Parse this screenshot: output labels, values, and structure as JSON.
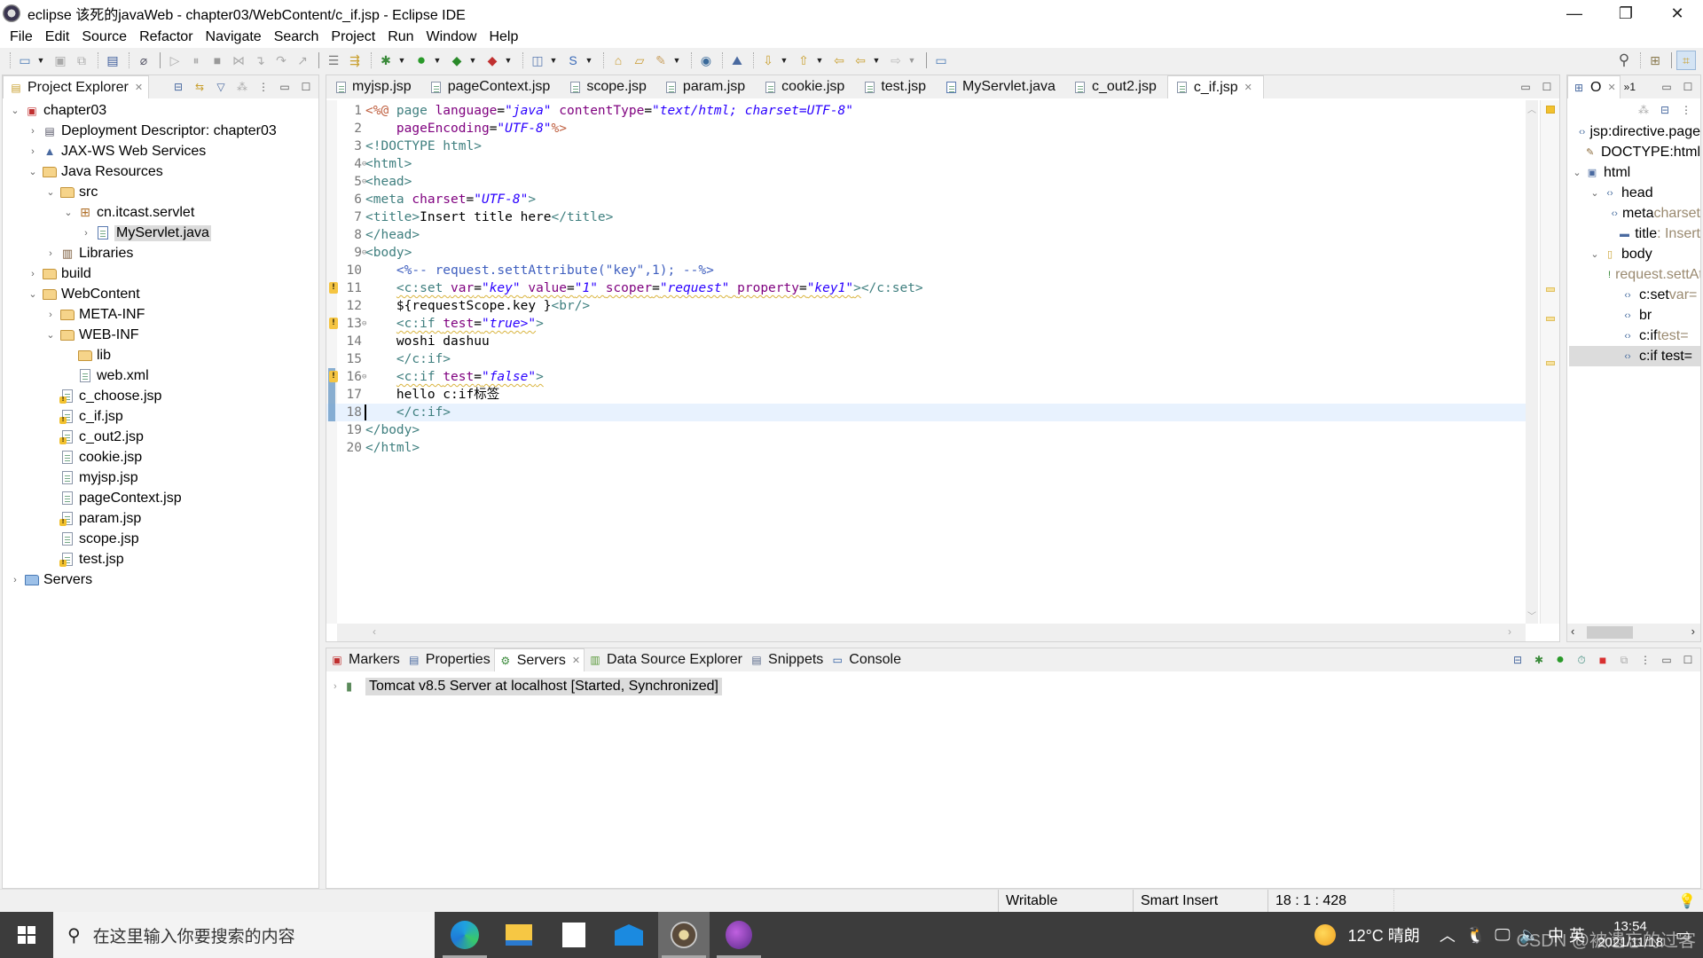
{
  "window": {
    "title": "eclipse 该死的javaWeb - chapter03/WebContent/c_if.jsp - Eclipse IDE",
    "minimize": "—",
    "restore": "❐",
    "close": "✕"
  },
  "menu": [
    "File",
    "Edit",
    "Source",
    "Refactor",
    "Navigate",
    "Search",
    "Project",
    "Run",
    "Window",
    "Help"
  ],
  "explorer": {
    "title": "Project Explorer",
    "tree": [
      {
        "label": "chapter03",
        "depth": 0,
        "twisty": "open",
        "icon": "project-icon"
      },
      {
        "label": "Deployment Descriptor: chapter03",
        "depth": 1,
        "twisty": "closed",
        "icon": "deployment-descriptor-icon"
      },
      {
        "label": "JAX-WS Web Services",
        "depth": 1,
        "twisty": "closed",
        "icon": "web-services-icon"
      },
      {
        "label": "Java Resources",
        "depth": 1,
        "twisty": "open",
        "icon": "java-resources-icon"
      },
      {
        "label": "src",
        "depth": 2,
        "twisty": "open",
        "icon": "source-folder-icon"
      },
      {
        "label": "cn.itcast.servlet",
        "depth": 3,
        "twisty": "open",
        "icon": "package-icon"
      },
      {
        "label": "MyServlet.java",
        "depth": 4,
        "twisty": "closed",
        "icon": "java-file-icon",
        "selected": true
      },
      {
        "label": "Libraries",
        "depth": 2,
        "twisty": "closed",
        "icon": "libraries-icon"
      },
      {
        "label": "build",
        "depth": 1,
        "twisty": "closed",
        "icon": "folder-icon"
      },
      {
        "label": "WebContent",
        "depth": 1,
        "twisty": "open",
        "icon": "folder-icon"
      },
      {
        "label": "META-INF",
        "depth": 2,
        "twisty": "closed",
        "icon": "folder-icon"
      },
      {
        "label": "WEB-INF",
        "depth": 2,
        "twisty": "open",
        "icon": "folder-icon"
      },
      {
        "label": "lib",
        "depth": 3,
        "twisty": "none",
        "icon": "folder-icon"
      },
      {
        "label": "web.xml",
        "depth": 3,
        "twisty": "none",
        "icon": "xml-file-icon"
      },
      {
        "label": "c_choose.jsp",
        "depth": 2,
        "twisty": "none",
        "icon": "jsp-file-warning-icon"
      },
      {
        "label": "c_if.jsp",
        "depth": 2,
        "twisty": "none",
        "icon": "jsp-file-warning-icon"
      },
      {
        "label": "c_out2.jsp",
        "depth": 2,
        "twisty": "none",
        "icon": "jsp-file-warning-icon"
      },
      {
        "label": "cookie.jsp",
        "depth": 2,
        "twisty": "none",
        "icon": "jsp-file-icon"
      },
      {
        "label": "myjsp.jsp",
        "depth": 2,
        "twisty": "none",
        "icon": "jsp-file-icon"
      },
      {
        "label": "pageContext.jsp",
        "depth": 2,
        "twisty": "none",
        "icon": "jsp-file-icon"
      },
      {
        "label": "param.jsp",
        "depth": 2,
        "twisty": "none",
        "icon": "jsp-file-warning-icon"
      },
      {
        "label": "scope.jsp",
        "depth": 2,
        "twisty": "none",
        "icon": "jsp-file-icon"
      },
      {
        "label": "test.jsp",
        "depth": 2,
        "twisty": "none",
        "icon": "jsp-file-warning-icon"
      },
      {
        "label": "Servers",
        "depth": 0,
        "twisty": "closed",
        "icon": "servers-folder-icon"
      }
    ]
  },
  "editor": {
    "tabs": [
      {
        "label": "myjsp.jsp",
        "icon": "jsp-file-icon"
      },
      {
        "label": "pageContext.jsp",
        "icon": "jsp-file-icon"
      },
      {
        "label": "scope.jsp",
        "icon": "jsp-file-icon"
      },
      {
        "label": "param.jsp",
        "icon": "jsp-file-icon"
      },
      {
        "label": "cookie.jsp",
        "icon": "jsp-file-icon"
      },
      {
        "label": "test.jsp",
        "icon": "jsp-file-icon"
      },
      {
        "label": "MyServlet.java",
        "icon": "java-file-icon"
      },
      {
        "label": "c_out2.jsp",
        "icon": "jsp-file-icon"
      },
      {
        "label": "c_if.jsp",
        "icon": "jsp-file-icon",
        "active": true
      }
    ],
    "current_line": 18,
    "lines": [
      {
        "n": "1",
        "fold": false,
        "warn": false,
        "tokens": [
          [
            "jspd",
            "<%@ "
          ],
          [
            "tag",
            "page "
          ],
          [
            "attr",
            "language"
          ],
          [
            "txt",
            "="
          ],
          [
            "val",
            "\"java\""
          ],
          [
            "txt",
            " "
          ],
          [
            "attr",
            "contentType"
          ],
          [
            "txt",
            "="
          ],
          [
            "val",
            "\"text/html; charset=UTF-8\""
          ]
        ]
      },
      {
        "n": "2",
        "fold": false,
        "warn": false,
        "tokens": [
          [
            "txt",
            "    "
          ],
          [
            "attr",
            "pageEncoding"
          ],
          [
            "txt",
            "="
          ],
          [
            "val",
            "\"UTF-8\""
          ],
          [
            "jspd",
            "%>"
          ]
        ]
      },
      {
        "n": "3",
        "fold": false,
        "warn": false,
        "tokens": [
          [
            "tag",
            "<!DOCTYPE html>"
          ]
        ]
      },
      {
        "n": "4",
        "fold": true,
        "warn": false,
        "tokens": [
          [
            "tag",
            "<html>"
          ]
        ]
      },
      {
        "n": "5",
        "fold": true,
        "warn": false,
        "tokens": [
          [
            "tag",
            "<head>"
          ]
        ]
      },
      {
        "n": "6",
        "fold": false,
        "warn": false,
        "tokens": [
          [
            "tag",
            "<meta "
          ],
          [
            "attr",
            "charset"
          ],
          [
            "txt",
            "="
          ],
          [
            "val",
            "\"UTF-8\""
          ],
          [
            "tag",
            ">"
          ]
        ]
      },
      {
        "n": "7",
        "fold": false,
        "warn": false,
        "tokens": [
          [
            "tag",
            "<title>"
          ],
          [
            "txt",
            "Insert title here"
          ],
          [
            "tag",
            "</title>"
          ]
        ]
      },
      {
        "n": "8",
        "fold": false,
        "warn": false,
        "tokens": [
          [
            "tag",
            "</head>"
          ]
        ]
      },
      {
        "n": "9",
        "fold": true,
        "warn": false,
        "tokens": [
          [
            "tag",
            "<body>"
          ]
        ]
      },
      {
        "n": "10",
        "fold": false,
        "warn": false,
        "tokens": [
          [
            "txt",
            "    "
          ],
          [
            "cmt",
            "<%-- request.settAttribute(\"key\",1); --%>"
          ]
        ]
      },
      {
        "n": "11",
        "fold": false,
        "warn": true,
        "tokens": [
          [
            "txt",
            "    "
          ],
          [
            "tag squig",
            "<c:set "
          ],
          [
            "attr squig",
            "var"
          ],
          [
            "txt squig",
            "="
          ],
          [
            "val squig",
            "\"key\""
          ],
          [
            "txt squig",
            " "
          ],
          [
            "attr squig",
            "value"
          ],
          [
            "txt squig",
            "="
          ],
          [
            "val squig",
            "\"1\""
          ],
          [
            "txt squig",
            " "
          ],
          [
            "attr squig",
            "scoper"
          ],
          [
            "txt squig",
            "="
          ],
          [
            "val squig",
            "\"request\""
          ],
          [
            "txt squig",
            " "
          ],
          [
            "attr squig",
            "property"
          ],
          [
            "txt squig",
            "="
          ],
          [
            "val squig",
            "\"key1\""
          ],
          [
            "tag squig",
            ">"
          ],
          [
            "tag",
            "</c:set>"
          ]
        ]
      },
      {
        "n": "12",
        "fold": false,
        "warn": false,
        "tokens": [
          [
            "txt",
            "    ${requestScope.key }"
          ],
          [
            "tag",
            "<br/>"
          ]
        ]
      },
      {
        "n": "13",
        "fold": true,
        "warn": true,
        "tokens": [
          [
            "txt",
            "    "
          ],
          [
            "tag squig",
            "<c:if "
          ],
          [
            "attr squig",
            "test"
          ],
          [
            "txt squig",
            "="
          ],
          [
            "val squig",
            "\"true>\""
          ],
          [
            "tag",
            ">"
          ]
        ]
      },
      {
        "n": "14",
        "fold": false,
        "warn": false,
        "tokens": [
          [
            "txt",
            "    woshi dashuu"
          ]
        ]
      },
      {
        "n": "15",
        "fold": false,
        "warn": false,
        "tokens": [
          [
            "txt",
            "    "
          ],
          [
            "tag",
            "</c:if>"
          ]
        ]
      },
      {
        "n": "16",
        "fold": true,
        "warn": true,
        "tokens": [
          [
            "txt",
            "    "
          ],
          [
            "tag squig",
            "<c:if "
          ],
          [
            "attr squig",
            "test"
          ],
          [
            "txt squig",
            "="
          ],
          [
            "val squig",
            "\"false\""
          ],
          [
            "tag squig",
            ">"
          ]
        ]
      },
      {
        "n": "17",
        "fold": false,
        "warn": false,
        "tokens": [
          [
            "txt",
            "    hello c:if标签"
          ]
        ]
      },
      {
        "n": "18",
        "fold": false,
        "warn": false,
        "tokens": [
          [
            "txt",
            "    "
          ],
          [
            "tag",
            "</c:if>"
          ]
        ]
      },
      {
        "n": "19",
        "fold": false,
        "warn": false,
        "tokens": [
          [
            "tag",
            "</body>"
          ]
        ]
      },
      {
        "n": "20",
        "fold": false,
        "warn": false,
        "tokens": [
          [
            "tag",
            "</html>"
          ]
        ]
      }
    ]
  },
  "outline": {
    "title": "O",
    "overflow_label": "»1",
    "items": [
      {
        "label": "jsp:directive.page",
        "extra": "",
        "depth": 0,
        "twisty": "none",
        "icon": "element-icon"
      },
      {
        "label": "DOCTYPE:html",
        "extra": "",
        "depth": 0,
        "twisty": "none",
        "icon": "doctype-icon"
      },
      {
        "label": "html",
        "extra": "",
        "depth": 0,
        "twisty": "open",
        "icon": "html-element-icon"
      },
      {
        "label": "head",
        "extra": "",
        "depth": 1,
        "twisty": "open",
        "icon": "element-icon"
      },
      {
        "label": "meta",
        "extra": " charset",
        "depth": 2,
        "twisty": "none",
        "icon": "element-icon"
      },
      {
        "label": "title",
        "extra": " : Insert",
        "depth": 2,
        "twisty": "none",
        "icon": "title-element-icon"
      },
      {
        "label": "body",
        "extra": "",
        "depth": 1,
        "twisty": "open",
        "icon": "body-element-icon"
      },
      {
        "label": "",
        "extra": "request.settAttribute",
        "depth": 2,
        "twisty": "none",
        "icon": "comment-icon"
      },
      {
        "label": "c:set",
        "extra": " var=",
        "depth": 2,
        "twisty": "none",
        "icon": "element-icon"
      },
      {
        "label": "br",
        "extra": "",
        "depth": 2,
        "twisty": "none",
        "icon": "element-icon"
      },
      {
        "label": "c:if",
        "extra": " test=",
        "depth": 2,
        "twisty": "none",
        "icon": "element-icon"
      },
      {
        "label": "c:if test=",
        "extra": "",
        "depth": 2,
        "twisty": "none",
        "icon": "element-icon",
        "selected": true
      }
    ]
  },
  "bottom": {
    "tabs": [
      {
        "label": "Markers",
        "icon": "markers-icon"
      },
      {
        "label": "Properties",
        "icon": "properties-icon"
      },
      {
        "label": "Servers",
        "icon": "servers-icon",
        "active": true
      },
      {
        "label": "Data Source Explorer",
        "icon": "data-source-icon"
      },
      {
        "label": "Snippets",
        "icon": "snippets-icon"
      },
      {
        "label": "Console",
        "icon": "console-icon"
      }
    ],
    "server": "Tomcat v8.5 Server at localhost  [Started, Synchronized]"
  },
  "status": {
    "writable": "Writable",
    "insert_mode": "Smart Insert",
    "position": "18 : 1 : 428"
  },
  "taskbar": {
    "search_placeholder": "在这里输入你要搜索的内容",
    "weather": "12°C  晴朗",
    "ime": "中",
    "lang": "英",
    "time": "13:54",
    "date": "2021/11/18",
    "watermark": "CSDN @被遗忘的过客"
  },
  "colors": {
    "tag": "#3f7f7f",
    "attr": "#7f007f",
    "value": "#2a00ff",
    "jsp_delimiter": "#bf5f3f",
    "comment": "#3f5fbf",
    "current_line": "#e8f2fe",
    "warning": "#f5c542"
  }
}
